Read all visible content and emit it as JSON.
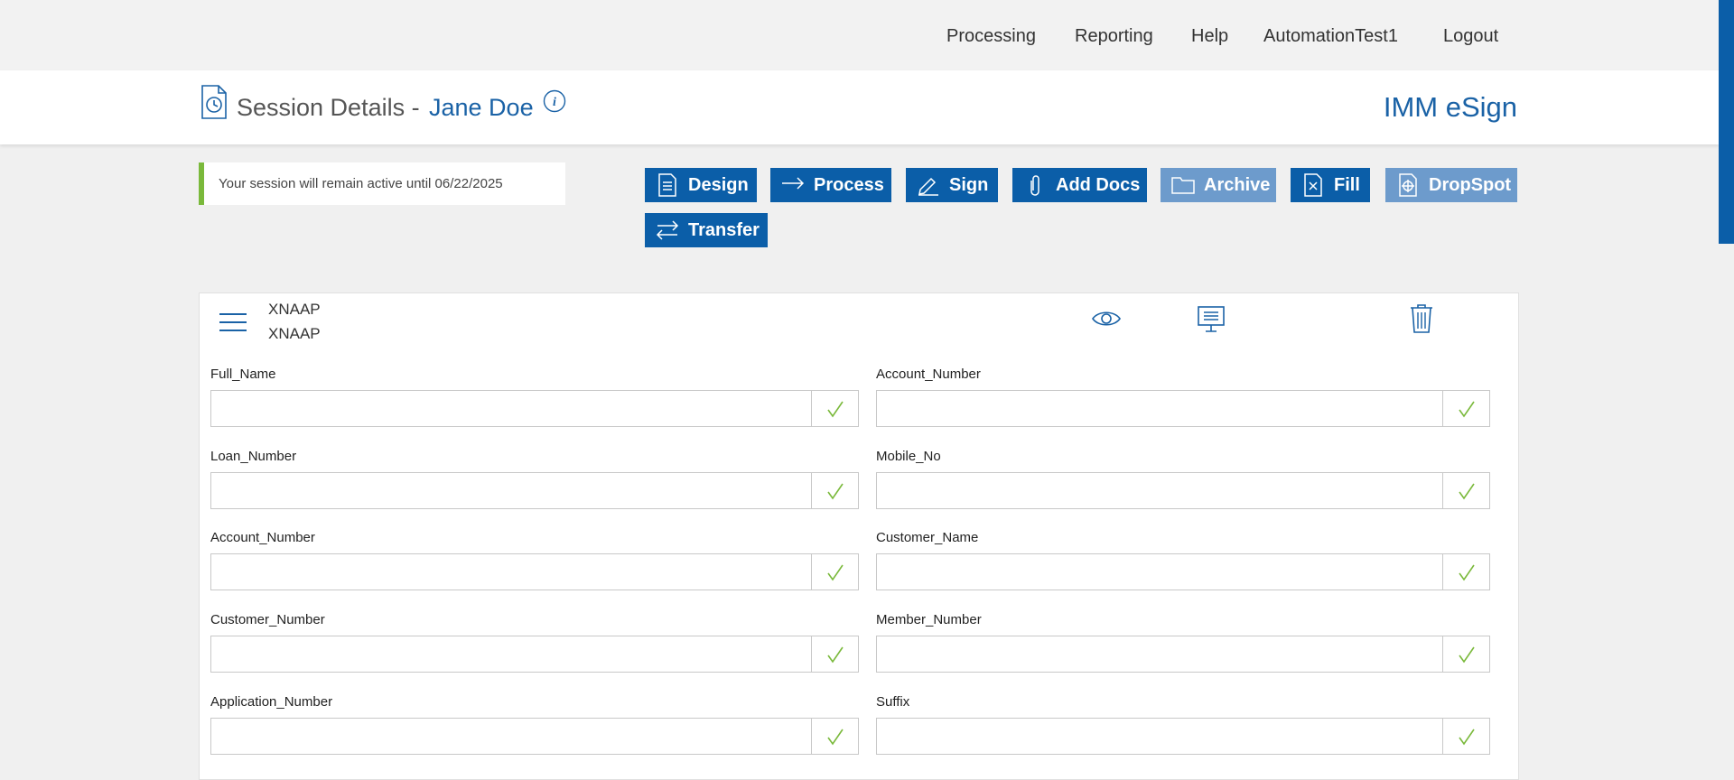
{
  "nav": {
    "items": [
      "Processing",
      "Reporting",
      "Help",
      "AutomationTest1",
      "Logout"
    ]
  },
  "header": {
    "title": "Session Details -",
    "name": "Jane Doe",
    "brand": "IMM eSign"
  },
  "notice": {
    "text": "Your session will remain active until 06/22/2025"
  },
  "actions": {
    "design": "Design",
    "process": "Process",
    "sign": "Sign",
    "add_docs": "Add Docs",
    "archive": "Archive",
    "fill": "Fill",
    "dropspot": "DropSpot",
    "transfer": "Transfer"
  },
  "document": {
    "line1": "XNAAP",
    "line2": "XNAAP"
  },
  "fields": [
    {
      "label": "Full_Name",
      "value": ""
    },
    {
      "label": "Account_Number",
      "value": ""
    },
    {
      "label": "Loan_Number",
      "value": ""
    },
    {
      "label": "Mobile_No",
      "value": ""
    },
    {
      "label": "Account_Number",
      "value": ""
    },
    {
      "label": "Customer_Name",
      "value": ""
    },
    {
      "label": "Customer_Number",
      "value": ""
    },
    {
      "label": "Member_Number",
      "value": ""
    },
    {
      "label": "Application_Number",
      "value": ""
    },
    {
      "label": "Suffix",
      "value": ""
    }
  ],
  "colors": {
    "primary": "#0b5ea8",
    "primary_light": "#6d9bcc",
    "brand_text": "#1a62a6",
    "notice_accent": "#7ab93b",
    "check": "#7ab93b"
  }
}
